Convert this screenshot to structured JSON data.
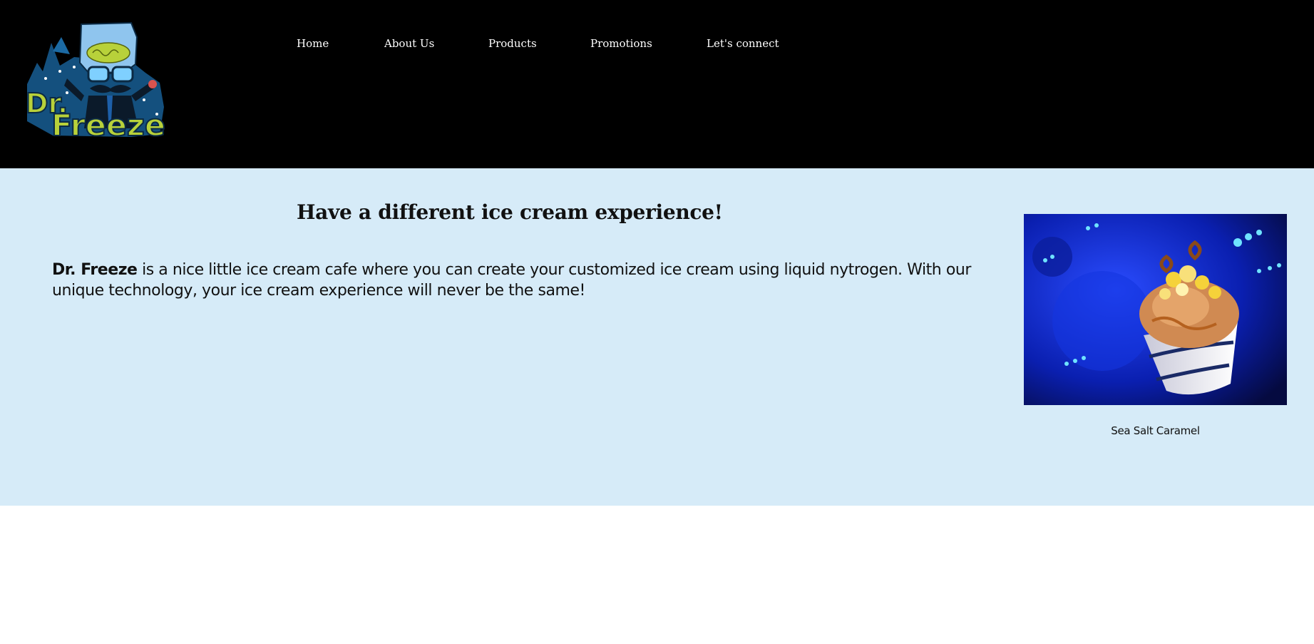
{
  "brand": {
    "logo_text_line1": "Dr.",
    "logo_text_line2": "Freeze"
  },
  "nav": {
    "items": [
      {
        "label": "Home"
      },
      {
        "label": "About Us"
      },
      {
        "label": "Products"
      },
      {
        "label": "Promotions"
      },
      {
        "label": "Let's connect"
      }
    ]
  },
  "main": {
    "headline": "Have a different ice cream experience!",
    "intro_brand": "Dr. Freeze",
    "intro_text": " is a nice little ice cream cafe where you can create your customized ice cream using liquid nytrogen. With our unique technology, your ice cream experience will never be the same!"
  },
  "feature": {
    "caption": "Sea Salt Caramel"
  },
  "colors": {
    "header_bg": "#000000",
    "main_bg": "#d6ebf8",
    "logo_green": "#b8d13a",
    "logo_blue": "#1d5fa8",
    "photo_blue": "#1230d8"
  }
}
